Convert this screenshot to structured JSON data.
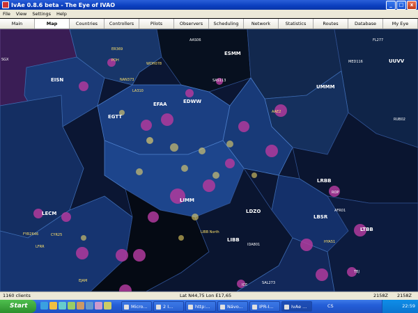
{
  "window": {
    "title": "IvAe 0.8.6 beta - The Eye of IVAO",
    "buttons": {
      "minimize": "_",
      "maximize": "□",
      "close": "x"
    }
  },
  "menu": [
    "File",
    "View",
    "Settings",
    "Help"
  ],
  "tabs": [
    "Main",
    "Map",
    "Countries",
    "Controllers",
    "Pilots",
    "Observers",
    "Scheduling",
    "Network",
    "Statistics",
    "Routes",
    "Database",
    "My Eye"
  ],
  "active_tab": "Map",
  "map": {
    "regions": [
      "ESMM",
      "EISN",
      "UMMM",
      "EDWW",
      "EFAA",
      "EGTT",
      "LRBB",
      "LECM",
      "LIMM",
      "LDZO",
      "LBSR",
      "LTBB",
      "UUVV",
      "LIBB"
    ],
    "labels": [
      {
        "text": "SGX"
      },
      {
        "text": "ER369"
      },
      {
        "text": "POH"
      },
      {
        "text": "WDH078"
      },
      {
        "text": "AAS06"
      },
      {
        "text": "NAN373"
      },
      {
        "text": "LA310"
      },
      {
        "text": "SAS113"
      },
      {
        "text": "MED116"
      },
      {
        "text": "FL277"
      },
      {
        "text": "EGTT"
      },
      {
        "text": "EFAA"
      },
      {
        "text": "EDWW"
      },
      {
        "text": "UMMM"
      },
      {
        "text": "LIMM"
      },
      {
        "text": "LRBB"
      },
      {
        "text": "LTBB"
      },
      {
        "text": "LBSR"
      },
      {
        "text": "LDZO"
      },
      {
        "text": "LECM"
      },
      {
        "text": "EOVV"
      },
      {
        "text": "LHCC"
      },
      {
        "text": "LFEE"
      },
      {
        "text": "LFMM"
      },
      {
        "text": "LIBB"
      },
      {
        "text": "AAE2"
      },
      {
        "text": "RUB02"
      },
      {
        "text": "CYR25"
      },
      {
        "text": "SAL273"
      },
      {
        "text": "EJAM"
      },
      {
        "text": "LIBB North"
      },
      {
        "text": "LDZO"
      },
      {
        "text": "LFRR"
      },
      {
        "text": "HYA51"
      },
      {
        "text": "AFR01"
      },
      {
        "text": "FYR2646"
      },
      {
        "text": "ICE"
      },
      {
        "text": "IDA801"
      },
      {
        "text": "TBJ"
      },
      {
        "text": "ROP"
      }
    ]
  },
  "status": {
    "clients": "1160 clients",
    "position": "Lat N44,75 Lon E17,65",
    "time1": "2158Z",
    "time2": "2158Z"
  },
  "taskbar": {
    "start": "Start",
    "items": [
      "Micro...",
      "2 I...",
      "http:...",
      "Návo...",
      "IPR-I...",
      "IvAe ..."
    ],
    "tray_text": "CS",
    "clock": "22:59"
  }
}
